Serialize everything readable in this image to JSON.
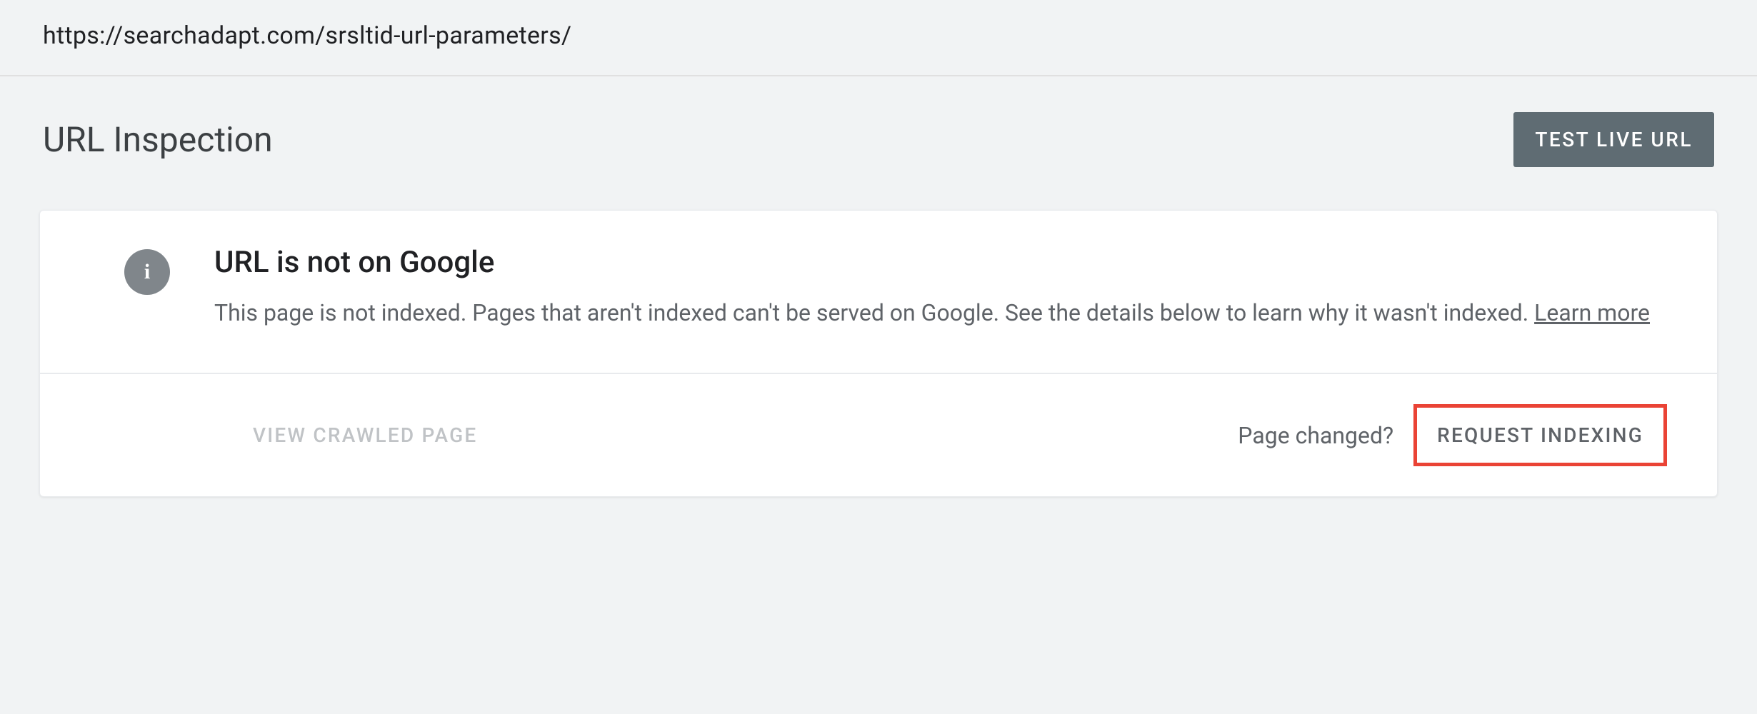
{
  "url": "https://searchadapt.com/srsltid-url-parameters/",
  "pageTitle": "URL Inspection",
  "testLiveButton": "TEST LIVE URL",
  "status": {
    "title": "URL is not on Google",
    "description": "This page is not indexed. Pages that aren't indexed can't be served on Google. See the details below to learn why it wasn't indexed. ",
    "learnMore": "Learn more"
  },
  "footer": {
    "viewCrawled": "VIEW CRAWLED PAGE",
    "pageChanged": "Page changed?",
    "requestIndexing": "REQUEST INDEXING"
  },
  "icons": {
    "info": "i"
  }
}
